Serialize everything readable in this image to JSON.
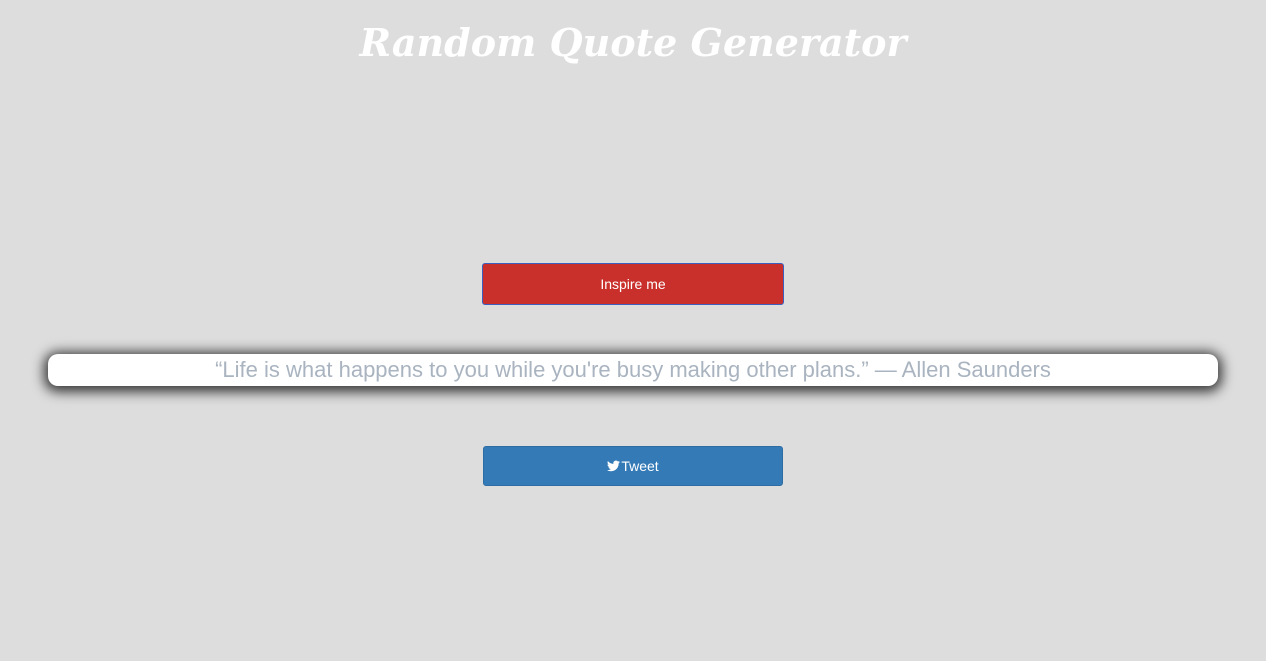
{
  "header": {
    "title": "Random Quote Generator"
  },
  "actions": {
    "inspire_label": "Inspire me",
    "tweet_label": "Tweet"
  },
  "quote": {
    "text": "“Life is what happens to you while you're busy making other plans.” — Allen Saunders"
  },
  "icons": {
    "tweet": "twitter-bird-icon"
  },
  "colors": {
    "background": "#dddddd",
    "inspire_button": "#c9302c",
    "tweet_button": "#337ab7",
    "quote_text": "#a9b4c0"
  }
}
